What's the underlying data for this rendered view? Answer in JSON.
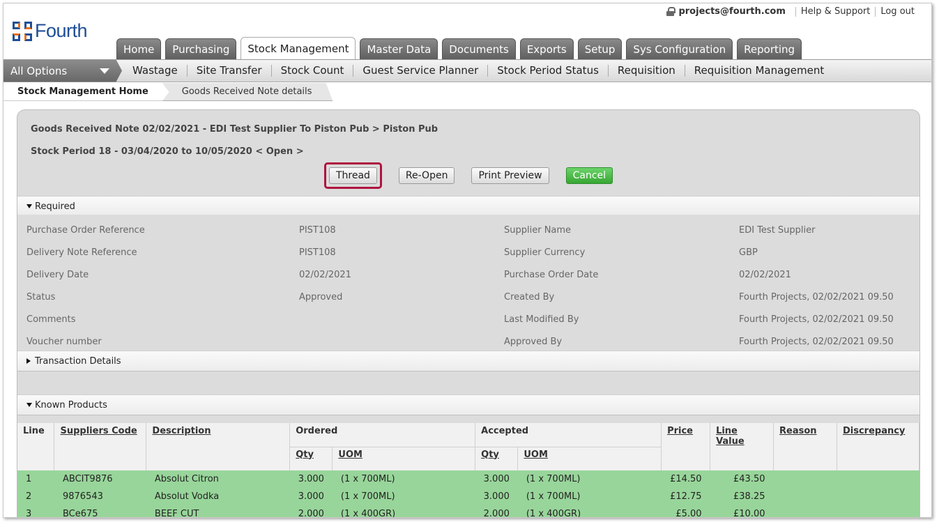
{
  "header": {
    "logo_text": "Fourth",
    "user": "projects@fourth.com",
    "help_link": "Help & Support",
    "logout_link": "Log out"
  },
  "tabs": [
    "Home",
    "Purchasing",
    "Stock Management",
    "Master Data",
    "Documents",
    "Exports",
    "Setup",
    "Sys Configuration",
    "Reporting"
  ],
  "active_tab": "Stock Management",
  "subnav": {
    "all_options": "All Options",
    "items": [
      "Wastage",
      "Site Transfer",
      "Stock Count",
      "Guest Service Planner",
      "Stock Period Status",
      "Requisition",
      "Requisition Management"
    ]
  },
  "breadcrumb": [
    "Stock Management Home",
    "Goods Received Note details"
  ],
  "page": {
    "title": "Goods Received Note 02/02/2021 - EDI Test Supplier To Piston Pub > Piston Pub",
    "stock_period": "Stock Period 18 - 03/04/2020 to 10/05/2020 < Open >"
  },
  "buttons": {
    "thread": "Thread",
    "reopen": "Re-Open",
    "print_preview": "Print Preview",
    "cancel": "Cancel"
  },
  "sections": {
    "required": "Required",
    "transaction_details": "Transaction Details",
    "known_products": "Known Products"
  },
  "fields": [
    {
      "label": "Purchase Order Reference",
      "value": "PIST108",
      "label2": "Supplier Name",
      "value2": "EDI Test Supplier"
    },
    {
      "label": "Delivery Note Reference",
      "value": "PIST108",
      "label2": "Supplier Currency",
      "value2": "GBP"
    },
    {
      "label": "Delivery Date",
      "value": "02/02/2021",
      "label2": "Purchase Order Date",
      "value2": "02/02/2021"
    },
    {
      "label": "Status",
      "value": "Approved",
      "label2": "Created By",
      "value2": "Fourth Projects, 02/02/2021 09.50"
    },
    {
      "label": "Comments",
      "value": "",
      "label2": "Last Modified By",
      "value2": "Fourth Projects, 02/02/2021 09.50"
    },
    {
      "label": "Voucher number",
      "value": "",
      "label2": "Approved By",
      "value2": "Fourth Projects, 02/02/2021 09.50"
    }
  ],
  "products": {
    "headers": {
      "line": "Line",
      "suppliers_code": "Suppliers Code",
      "description": "Description",
      "ordered": "Ordered",
      "accepted": "Accepted",
      "qty": "Qty",
      "uom": "UOM",
      "price": "Price",
      "line_value": "Line Value",
      "reason": "Reason",
      "discrepancy": "Discrepancy"
    },
    "rows": [
      [
        "1",
        "ABCIT9876",
        "Absolut Citron",
        "3.000",
        "(1 x 700ML)",
        "3.000",
        "(1 x 700ML)",
        "£14.50",
        "£43.50"
      ],
      [
        "2",
        "9876543",
        "Absolut Vodka",
        "3.000",
        "(1 x 700ML)",
        "3.000",
        "(1 x 700ML)",
        "£12.75",
        "£38.25"
      ],
      [
        "3",
        "BCe675",
        "BEEF CUT",
        "2.000",
        "(1 x 400GR)",
        "2.000",
        "(1 x 400GR)",
        "£5.00",
        "£10.00"
      ]
    ]
  },
  "colors": {
    "brand_blue": "#1f4e96",
    "highlight": "#b0123f",
    "cancel_green": "#37a633",
    "row_green": "#98d59a"
  }
}
